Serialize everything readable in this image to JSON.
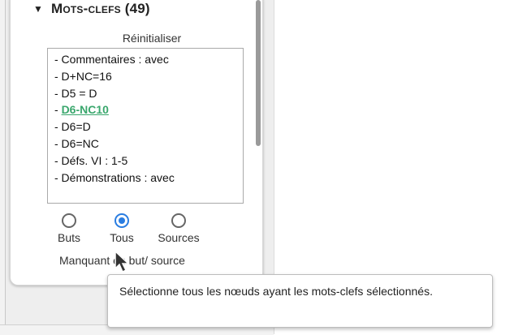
{
  "keywords_panel": {
    "toggle_icon": "triangle-down-icon",
    "title": "Mots-clefs (49)",
    "reset_label": "Réinitialiser",
    "items": [
      "- Commentaires : avec",
      "- D+NC=16",
      "- D5 = D",
      "- D6-NC10",
      "- D6=D",
      "- D6=NC",
      "- Défs. VI : 1-5",
      "- Démonstrations : avec"
    ],
    "selected_item_prefix": "- ",
    "selected_item_text": "D6-NC10",
    "radio_options": [
      "Buts",
      "Tous",
      "Sources"
    ],
    "selected_radio": "Tous",
    "missing_label": "Manquant en but/ source"
  },
  "tooltip": {
    "text": "Sélectionne tous les nœuds ayant les mots-clefs sélectionnés."
  },
  "colors": {
    "selected_link": "#3aa76d",
    "radio_active": "#2a7de1"
  }
}
